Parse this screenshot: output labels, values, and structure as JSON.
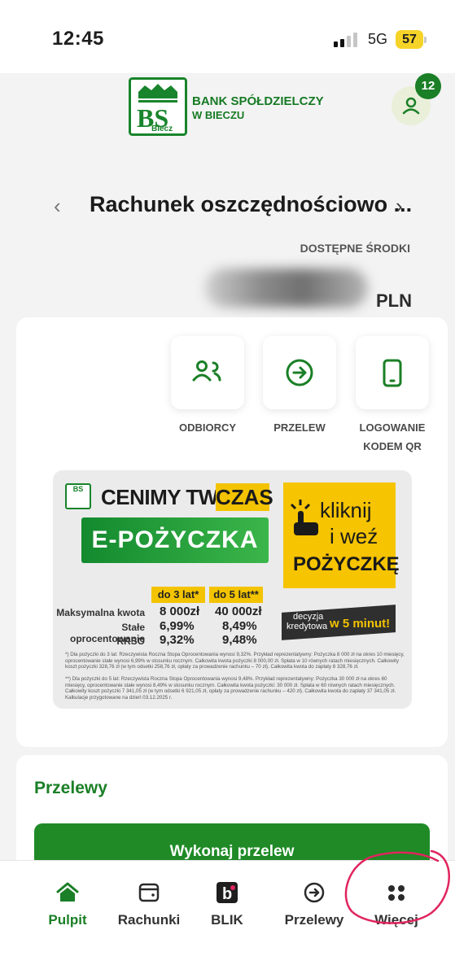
{
  "status_bar": {
    "time": "12:45",
    "network": "5G",
    "battery": "57"
  },
  "header": {
    "bank_name_line1": "BANK SPÓŁDZIELCZY",
    "bank_name_line2": "W BIECZU",
    "logo_text": "BS",
    "logo_subtext": "Biecz",
    "notification_count": "12"
  },
  "account": {
    "name": "Rachunek oszczędnościowo ...",
    "available_label": "DOSTĘPNE ŚRODKI",
    "currency": "PLN"
  },
  "actions": [
    {
      "label_line1": "ODBIORCY",
      "label_line2": "",
      "icon": "people-icon"
    },
    {
      "label_line1": "PRZELEW",
      "label_line2": "",
      "icon": "arrow-circle-icon"
    },
    {
      "label_line1": "LOGOWANIE",
      "label_line2": "KODEM QR",
      "icon": "phone-icon"
    }
  ],
  "promo": {
    "headline": "CENIMY TWÓJ",
    "headline_highlight": "CZAS",
    "product": "E-POŻYCZKA",
    "cta_line1": "kliknij",
    "cta_line2": "i weź",
    "cta_line3": "POŻYCZKĘ",
    "col1_header": "do 3 lat*",
    "col2_header": "do 5 lat**",
    "rows": [
      {
        "label": "Maksymalna kwota",
        "v1": "8 000zł",
        "v2": "40 000zł"
      },
      {
        "label": "Stałe oprocentowanie",
        "v1": "6,99%",
        "v2": "8,49%"
      },
      {
        "label": "RRSO",
        "v1": "9,32%",
        "v2": "9,48%"
      }
    ],
    "decision_line1": "decyzja",
    "decision_line2": "kredytowa",
    "decision_highlight": "w 5 minut!",
    "fine_print_1": "*) Dla pożyczki do 3 lat: Rzeczywista Roczna Stopa Oprocentowania wynosi 9,32%. Przykład reprezentatywny: Pożyczka 8 000 zł na okres 10 miesięcy, oprocentowanie stałe wynosi 6,99% w stosunku rocznym. Całkowita kwota pożyczki 8 000,00 zł. Spłata w 10 równych ratach miesięcznych. Całkowity koszt pożyczki 328,76 zł (w tym odsetki 258,76 zł, opłaty za prowadzenie rachunku – 70 zł). Całkowita kwota do zapłaty 8 328,76 zł.",
    "fine_print_2": "**) Dla pożyczki do 5 lat: Rzeczywista Roczna Stopa Oprocentowania wynosi 9,48%. Przykład reprezentatywny: Pożyczka 30 000 zł na okres 60 miesięcy, oprocentowanie stałe wynosi 8,49% w stosunku rocznym. Całkowita kwota pożyczki: 30 000 zł. Spłata w 60 równych ratach miesięcznych. Całkowity koszt pożyczki 7 341,05 zł (w tym odsetki 6 921,05 zł, opłaty za prowadzenie rachunku – 420 zł). Całkowita kwota do zapłaty 37 341,05 zł. Kalkulacje przygotowane na dzień 03.12.2025 r."
  },
  "transfers": {
    "title": "Przelewy",
    "button_label": "Wykonaj przelew"
  },
  "nav": [
    {
      "label": "Pulpit",
      "icon": "home-icon",
      "active": true
    },
    {
      "label": "Rachunki",
      "icon": "wallet-icon",
      "active": false
    },
    {
      "label": "BLIK",
      "icon": "blik-icon",
      "active": false
    },
    {
      "label": "Przelewy",
      "icon": "arrow-circle-icon",
      "active": false
    },
    {
      "label": "Więcej",
      "icon": "more-icon",
      "active": false
    }
  ],
  "colors": {
    "brand_green": "#1a7f26",
    "accent_yellow": "#f3c300",
    "annotation": "#e0245e"
  }
}
